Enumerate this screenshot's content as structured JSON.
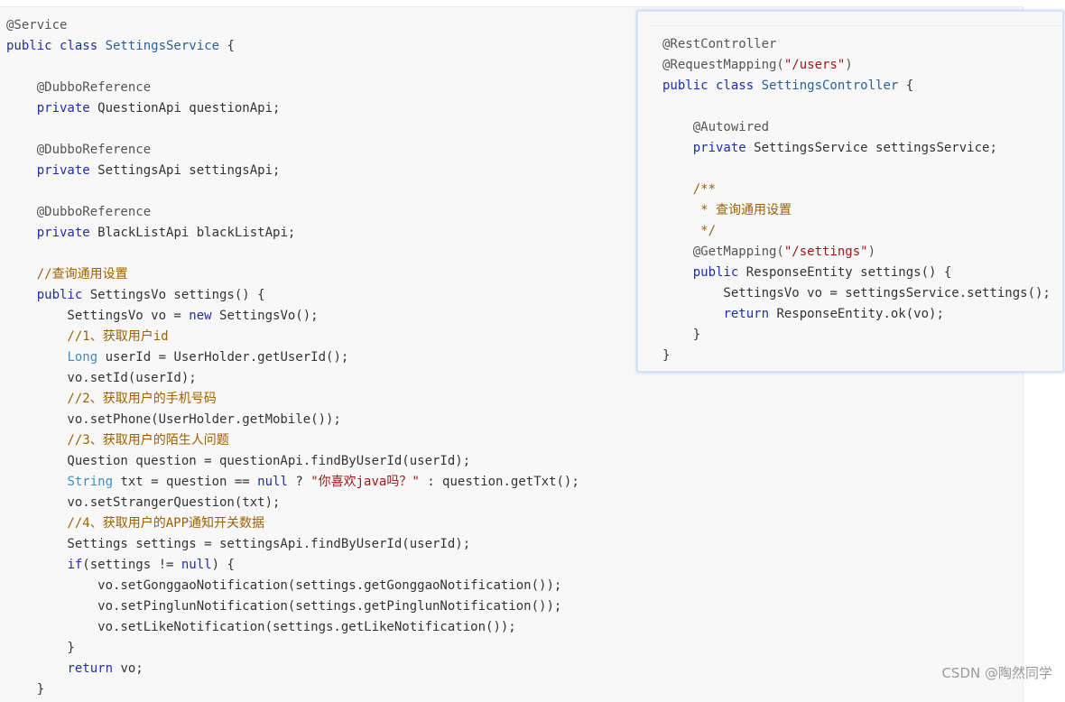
{
  "main_code": {
    "l01": [
      "@Service"
    ],
    "l02": [
      "public class ",
      "SettingsService",
      " {"
    ],
    "l04": [
      "    @DubboReference"
    ],
    "l05": [
      "    private ",
      "QuestionApi questionApi;"
    ],
    "l07": [
      "    @DubboReference"
    ],
    "l08": [
      "    private ",
      "SettingsApi settingsApi;"
    ],
    "l10": [
      "    @DubboReference"
    ],
    "l11": [
      "    private ",
      "BlackListApi blackListApi;"
    ],
    "l13": [
      "    //查询通用设置"
    ],
    "l14": [
      "    public ",
      "SettingsVo settings() {"
    ],
    "l15": [
      "        SettingsVo vo = ",
      "new",
      " SettingsVo();"
    ],
    "l16": [
      "        //1、获取用户id"
    ],
    "l17": [
      "        ",
      "Long",
      " userId = UserHolder.getUserId();"
    ],
    "l18": [
      "        vo.setId(userId);"
    ],
    "l19": [
      "        //2、获取用户的手机号码"
    ],
    "l20": [
      "        vo.setPhone(UserHolder.getMobile());"
    ],
    "l21": [
      "        //3、获取用户的陌生人问题"
    ],
    "l22": [
      "        Question question = questionApi.findByUserId(userId);"
    ],
    "l23": [
      "        ",
      "String",
      " txt = question == ",
      "null",
      " ? ",
      "\"你喜欢java吗？\"",
      " : question.getTxt();"
    ],
    "l24": [
      "        vo.setStrangerQuestion(txt);"
    ],
    "l25": [
      "        //4、获取用户的APP通知开关数据"
    ],
    "l26": [
      "        Settings settings = settingsApi.findByUserId(userId);"
    ],
    "l27": [
      "        ",
      "if",
      "(settings != ",
      "null",
      ") {"
    ],
    "l28": [
      "            vo.setGonggaoNotification(settings.getGonggaoNotification());"
    ],
    "l29": [
      "            vo.setPinglunNotification(settings.getPinglunNotification());"
    ],
    "l30": [
      "            vo.setLikeNotification(settings.getLikeNotification());"
    ],
    "l31": [
      "        }"
    ],
    "l32": [
      "        ",
      "return",
      " vo;"
    ],
    "l33": [
      "    }"
    ]
  },
  "popup_code": {
    "p01": [
      "@RestController"
    ],
    "p02": [
      "@RequestMapping(",
      "\"/users\"",
      ")"
    ],
    "p03": [
      "public class ",
      "SettingsController",
      " {"
    ],
    "p05": [
      "    @Autowired"
    ],
    "p06": [
      "    private ",
      "SettingsService settingsService;"
    ],
    "p08": [
      "    /**"
    ],
    "p09": [
      "     * 查询通用设置"
    ],
    "p10": [
      "     */"
    ],
    "p11": [
      "    @GetMapping(",
      "\"/settings\"",
      ")"
    ],
    "p12": [
      "    public ",
      "ResponseEntity settings() {"
    ],
    "p13": [
      "        SettingsVo vo = settingsService.settings();"
    ],
    "p14": [
      "        ",
      "return",
      " ResponseEntity.ok(vo);"
    ],
    "p15": [
      "    }"
    ],
    "p16": [
      "}"
    ]
  },
  "watermark": "CSDN @陶然同学",
  "colors": {
    "keyword": "#1d2db0",
    "class_name": "#2a6099",
    "annotation": "#555555",
    "string": "#a31515",
    "comment": "#a06000",
    "text": "#333333",
    "background": "#f8f8f8"
  }
}
